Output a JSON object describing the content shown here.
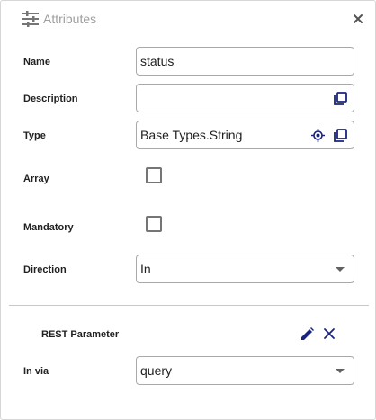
{
  "header": {
    "title": "Attributes",
    "icon": "sliders-icon",
    "close_icon": "close-icon"
  },
  "fields": {
    "name": {
      "label": "Name",
      "value": "status"
    },
    "description": {
      "label": "Description",
      "value": ""
    },
    "type": {
      "label": "Type",
      "value": "Base Types.String"
    },
    "array": {
      "label": "Array",
      "checked": false
    },
    "mandatory": {
      "label": "Mandatory",
      "checked": false
    },
    "direction": {
      "label": "Direction",
      "value": "In"
    }
  },
  "rest_section": {
    "title": "REST Parameter",
    "in_via": {
      "label": "In via",
      "value": "query"
    }
  },
  "colors": {
    "accent_icon": "#1a237e",
    "header_text": "#9e9e9e",
    "border": "#a9a9a9"
  }
}
